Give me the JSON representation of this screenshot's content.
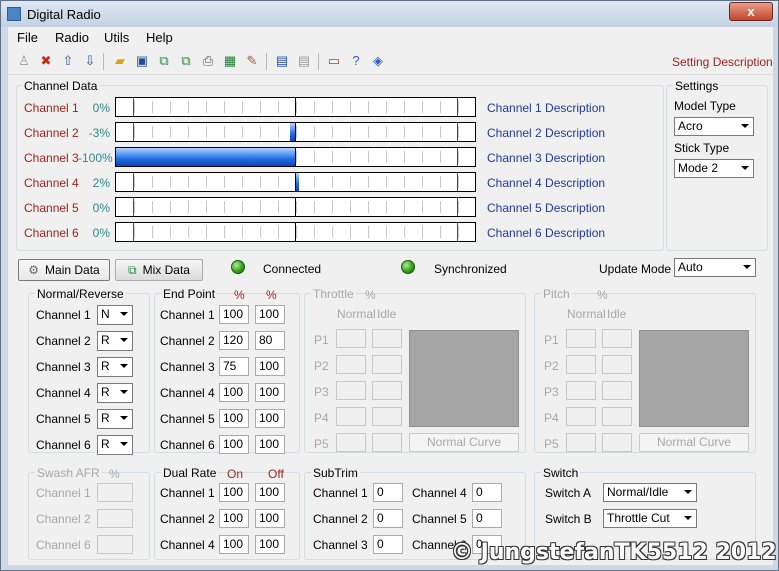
{
  "window": {
    "title": "Digital Radio",
    "close": "x"
  },
  "menu": [
    "File",
    "Radio",
    "Utils",
    "Help"
  ],
  "toolbar": {
    "setting_description": "Setting Description"
  },
  "channel_data": {
    "label": "Channel Data",
    "channels": [
      {
        "name": "Channel 1",
        "percent": "0%",
        "value": 0,
        "desc": "Channel 1 Description"
      },
      {
        "name": "Channel 2",
        "percent": "-3%",
        "value": -3,
        "desc": "Channel 2 Description"
      },
      {
        "name": "Channel 3",
        "percent": "-100%",
        "value": -100,
        "desc": "Channel 3 Description"
      },
      {
        "name": "Channel 4",
        "percent": "2%",
        "value": 2,
        "desc": "Channel 4 Description"
      },
      {
        "name": "Channel 5",
        "percent": "0%",
        "value": 0,
        "desc": "Channel 5 Description"
      },
      {
        "name": "Channel 6",
        "percent": "0%",
        "value": 0,
        "desc": "Channel 6 Description"
      }
    ]
  },
  "settings": {
    "label": "Settings",
    "model_type_label": "Model Type",
    "model_type": "Acro",
    "stick_type_label": "Stick Type",
    "stick_type": "Mode 2"
  },
  "tabs": {
    "main": "Main Data",
    "mix": "Mix Data"
  },
  "status": {
    "connected": "Connected",
    "synchronized": "Synchronized",
    "update_mode_label": "Update Mode",
    "update_mode": "Auto"
  },
  "normal_reverse": {
    "label": "Normal/Reverse",
    "rows": [
      {
        "name": "Channel 1",
        "value": "N"
      },
      {
        "name": "Channel 2",
        "value": "R"
      },
      {
        "name": "Channel 3",
        "value": "R"
      },
      {
        "name": "Channel 4",
        "value": "R"
      },
      {
        "name": "Channel 5",
        "value": "R"
      },
      {
        "name": "Channel 6",
        "value": "R"
      }
    ]
  },
  "end_point": {
    "label": "End Point",
    "col1": "%",
    "col2": "%",
    "rows": [
      {
        "name": "Channel 1",
        "a": "100",
        "b": "100"
      },
      {
        "name": "Channel 2",
        "a": "120",
        "b": "80"
      },
      {
        "name": "Channel 3",
        "a": "75",
        "b": "100"
      },
      {
        "name": "Channel 4",
        "a": "100",
        "b": "100"
      },
      {
        "name": "Channel 5",
        "a": "100",
        "b": "100"
      },
      {
        "name": "Channel 6",
        "a": "100",
        "b": "100"
      }
    ]
  },
  "throttle": {
    "label": "Throttle",
    "unit": "%",
    "normal": "Normal",
    "idle": "Idle",
    "points": [
      "P1",
      "P2",
      "P3",
      "P4",
      "P5"
    ],
    "curve_button": "Normal Curve"
  },
  "pitch": {
    "label": "Pitch",
    "unit": "%",
    "normal": "Normal",
    "idle": "Idle",
    "points": [
      "P1",
      "P2",
      "P3",
      "P4",
      "P5"
    ],
    "curve_button": "Normal Curve"
  },
  "swash": {
    "label": "Swash AFR",
    "unit": "%",
    "rows": [
      "Channel 1",
      "Channel 2",
      "Channel 6"
    ]
  },
  "dual_rate": {
    "label": "Dual Rate",
    "on": "On",
    "off": "Off",
    "rows": [
      {
        "name": "Channel 1",
        "on": "100",
        "off": "100"
      },
      {
        "name": "Channel 2",
        "on": "100",
        "off": "100"
      },
      {
        "name": "Channel 4",
        "on": "100",
        "off": "100"
      }
    ]
  },
  "subtrim": {
    "label": "SubTrim",
    "rows": [
      {
        "name": "Channel 1",
        "value": "0"
      },
      {
        "name": "Channel 2",
        "value": "0"
      },
      {
        "name": "Channel 3",
        "value": "0"
      },
      {
        "name": "Channel 4",
        "value": "0"
      },
      {
        "name": "Channel 5",
        "value": "0"
      },
      {
        "name": "Channel 6",
        "value": "0"
      }
    ]
  },
  "switch": {
    "label": "Switch",
    "a_label": "Switch A",
    "a_value": "Normal/Idle",
    "b_label": "Switch B",
    "b_value": "Throttle Cut"
  },
  "watermark": "© JungstefanTK5512  2012",
  "colors": {
    "accent_red": "#a0241f",
    "desc_blue": "#1f3aa0",
    "percent_teal": "#2a8a8a",
    "bar_fill": "#1e6ee6"
  }
}
